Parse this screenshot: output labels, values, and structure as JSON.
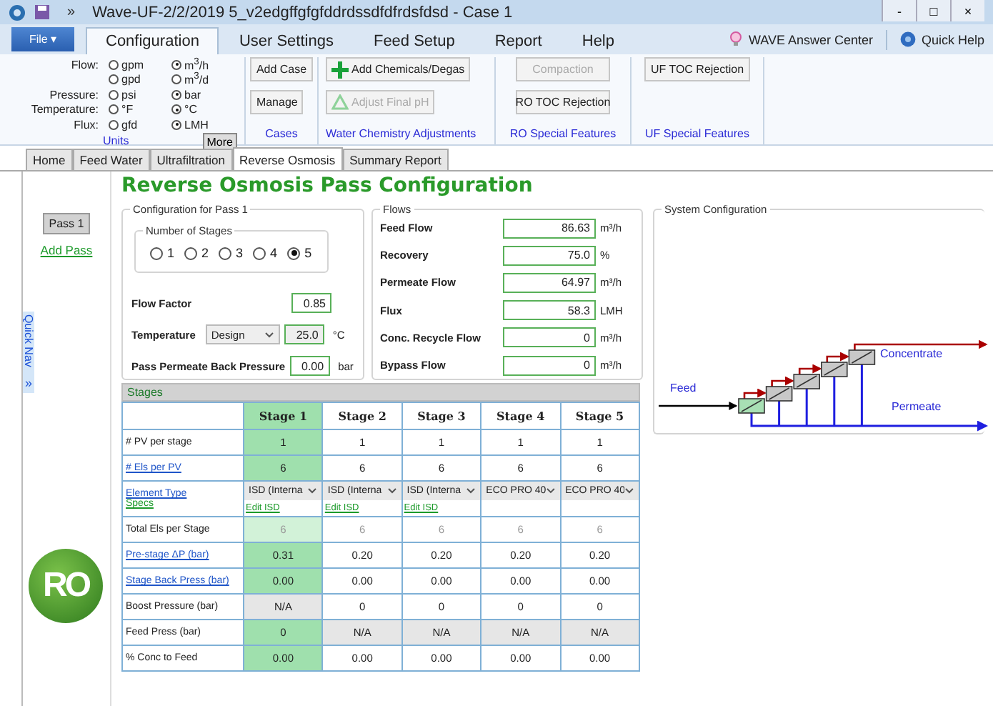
{
  "window": {
    "title": "Wave-UF-2/2/2019 5_v2edgffgfgfddrdssdfdfrdsfdsd - Case 1",
    "overflow": "»",
    "controls": [
      "-",
      "□",
      "×"
    ]
  },
  "ribbon": {
    "file": "File ▾",
    "tabs": [
      {
        "label": "Configuration",
        "selected": true
      },
      {
        "label": "User Settings",
        "selected": false
      },
      {
        "label": "Feed Setup",
        "selected": false
      },
      {
        "label": "Report",
        "selected": false
      },
      {
        "label": "Help",
        "selected": false
      }
    ],
    "links": [
      {
        "label": "WAVE Answer Center"
      },
      {
        "label": "Quick Help"
      }
    ],
    "units": {
      "title": "Units",
      "more": "More",
      "rows": [
        {
          "label": "Flow:",
          "options": [
            {
              "label": "gpm",
              "selected": false
            },
            {
              "label": "m$^{3}$/h",
              "selected": true
            }
          ]
        },
        {
          "options": [
            {
              "label": "gpd",
              "selected": false
            },
            {
              "label": "m$^{3}$/d",
              "selected": false
            }
          ]
        },
        {
          "label": "Pressure:",
          "options": [
            {
              "label": "psi",
              "selected": false
            },
            {
              "label": "bar",
              "selected": true
            }
          ]
        },
        {
          "label": "Temperature:",
          "options": [
            {
              "label": "°F",
              "selected": false
            },
            {
              "label": "°C",
              "selected": true
            }
          ]
        },
        {
          "label": "Flux:",
          "options": [
            {
              "label": "gfd",
              "selected": false
            },
            {
              "label": "LMH",
              "selected": true
            }
          ]
        }
      ]
    },
    "groups": [
      {
        "kind": "cases",
        "title": "Cases",
        "buttons": [
          {
            "label": "Add Case",
            "disabled": false
          },
          {
            "label": "Manage",
            "disabled": false
          }
        ]
      },
      {
        "kind": "chemistry",
        "title": "Water Chemistry Adjustments",
        "buttons": [
          {
            "label": "Add Chemicals/Degas",
            "disabled": false
          },
          {
            "label": "Adjust Final pH",
            "disabled": true
          }
        ]
      },
      {
        "kind": "ro",
        "title": "RO Special Features",
        "buttons": [
          {
            "label": "Compaction",
            "disabled": true
          },
          {
            "label": "RO TOC Rejection",
            "disabled": false
          }
        ]
      },
      {
        "kind": "uf",
        "title": "UF Special Features",
        "buttons": [
          {
            "label": "UF TOC Rejection",
            "disabled": false
          }
        ]
      }
    ]
  },
  "page_tabs": [
    {
      "label": "Home",
      "selected": false
    },
    {
      "label": "Feed Water",
      "selected": false
    },
    {
      "label": "Ultrafiltration",
      "selected": false
    },
    {
      "label": "Reverse Osmosis",
      "selected": true
    },
    {
      "label": "Summary Report",
      "selected": false
    }
  ],
  "sidebar": {
    "passes": [
      {
        "label": "Pass 1",
        "selected": true
      }
    ],
    "add_pass": "Add Pass",
    "quick_nav": "Quick Nav",
    "expand": "»",
    "logo_text": "RO"
  },
  "heading": "Reverse Osmosis Pass Configuration",
  "configuration": {
    "title": "Configuration for Pass 1",
    "stages_title": "Number of Stages",
    "stage_options": [
      {
        "label": "1",
        "selected": false
      },
      {
        "label": "2",
        "selected": false
      },
      {
        "label": "3",
        "selected": false
      },
      {
        "label": "4",
        "selected": false
      },
      {
        "label": "5",
        "selected": true
      }
    ],
    "flow_factor": {
      "label": "Flow Factor",
      "value": "0.85"
    },
    "temperature": {
      "label": "Temperature",
      "mode": "Design",
      "value": "25.0",
      "unit": "°C"
    },
    "back_pressure": {
      "label": "Pass Permeate Back Pressure",
      "value": "0.00",
      "unit": "bar"
    }
  },
  "flows": {
    "title": "Flows",
    "rows": [
      {
        "label": "Feed Flow",
        "value": "86.63",
        "unit": "m³/h"
      },
      {
        "label": "Recovery",
        "value": "75.0",
        "unit": "%"
      },
      {
        "label": "Permeate Flow",
        "value": "64.97",
        "unit": "m³/h"
      },
      {
        "label": "Flux",
        "value": "58.3",
        "unit": "LMH"
      },
      {
        "label": "Conc. Recycle Flow",
        "value": "0",
        "unit": "m³/h"
      },
      {
        "label": "Bypass Flow",
        "value": "0",
        "unit": "m³/h"
      }
    ]
  },
  "system_configuration": {
    "title": "System Configuration",
    "feed": "Feed",
    "concentrate": "Concentrate",
    "permeate": "Permeate"
  },
  "stages": {
    "title": "Stages",
    "columns": [
      {
        "label": "Stage 1",
        "selected": true
      },
      {
        "label": "Stage 2",
        "selected": false
      },
      {
        "label": "Stage 3",
        "selected": false
      },
      {
        "label": "Stage 4",
        "selected": false
      },
      {
        "label": "Stage 5",
        "selected": false
      }
    ],
    "rows": [
      {
        "kind": "value",
        "label": "# PV per stage",
        "link": false,
        "cells": [
          {
            "value": "1",
            "disabled": false,
            "readonly": false
          },
          {
            "value": "1",
            "disabled": false,
            "readonly": false
          },
          {
            "value": "1",
            "disabled": false,
            "readonly": false
          },
          {
            "value": "1",
            "disabled": false,
            "readonly": false
          },
          {
            "value": "1",
            "disabled": false,
            "readonly": false
          }
        ]
      },
      {
        "kind": "value",
        "label": "# Els per PV",
        "link": true,
        "cells": [
          {
            "value": "6",
            "disabled": false,
            "readonly": false
          },
          {
            "value": "6",
            "disabled": false,
            "readonly": false
          },
          {
            "value": "6",
            "disabled": false,
            "readonly": false
          },
          {
            "value": "6",
            "disabled": false,
            "readonly": false
          },
          {
            "value": "6",
            "disabled": false,
            "readonly": false
          }
        ]
      },
      {
        "kind": "element",
        "label": "Element Type",
        "sublabel": "Specs",
        "link": true,
        "cells": [
          {
            "value": "ISD (Interna",
            "edit": "Edit ISD"
          },
          {
            "value": "ISD (Interna",
            "edit": "Edit ISD"
          },
          {
            "value": "ISD (Interna",
            "edit": "Edit ISD"
          },
          {
            "value": "ECO PRO 40"
          },
          {
            "value": "ECO PRO 40"
          }
        ]
      },
      {
        "kind": "value",
        "label": "Total Els per Stage",
        "link": false,
        "cells": [
          {
            "value": "6",
            "disabled": false,
            "readonly": true
          },
          {
            "value": "6",
            "disabled": false,
            "readonly": true
          },
          {
            "value": "6",
            "disabled": false,
            "readonly": true
          },
          {
            "value": "6",
            "disabled": false,
            "readonly": true
          },
          {
            "value": "6",
            "disabled": false,
            "readonly": true
          }
        ]
      },
      {
        "kind": "value",
        "label": "Pre-stage ΔP (bar)",
        "link": true,
        "cells": [
          {
            "value": "0.31",
            "disabled": false,
            "readonly": false
          },
          {
            "value": "0.20",
            "disabled": false,
            "readonly": false
          },
          {
            "value": "0.20",
            "disabled": false,
            "readonly": false
          },
          {
            "value": "0.20",
            "disabled": false,
            "readonly": false
          },
          {
            "value": "0.20",
            "disabled": false,
            "readonly": false
          }
        ]
      },
      {
        "kind": "value",
        "label": "Stage Back Press (bar)",
        "link": true,
        "cells": [
          {
            "value": "0.00",
            "disabled": false,
            "readonly": false
          },
          {
            "value": "0.00",
            "disabled": false,
            "readonly": false
          },
          {
            "value": "0.00",
            "disabled": false,
            "readonly": false
          },
          {
            "value": "0.00",
            "disabled": false,
            "readonly": false
          },
          {
            "value": "0.00",
            "disabled": false,
            "readonly": false
          }
        ]
      },
      {
        "kind": "value",
        "label": "Boost Pressure (bar)",
        "link": false,
        "cells": [
          {
            "value": "N/A",
            "disabled": true,
            "readonly": false
          },
          {
            "value": "0",
            "disabled": false,
            "readonly": false
          },
          {
            "value": "0",
            "disabled": false,
            "readonly": false
          },
          {
            "value": "0",
            "disabled": false,
            "readonly": false
          },
          {
            "value": "0",
            "disabled": false,
            "readonly": false
          }
        ]
      },
      {
        "kind": "value",
        "label": "Feed Press (bar)",
        "link": false,
        "cells": [
          {
            "value": "0",
            "disabled": false,
            "readonly": false
          },
          {
            "value": "N/A",
            "disabled": true,
            "readonly": false
          },
          {
            "value": "N/A",
            "disabled": true,
            "readonly": false
          },
          {
            "value": "N/A",
            "disabled": true,
            "readonly": false
          },
          {
            "value": "N/A",
            "disabled": true,
            "readonly": false
          }
        ]
      },
      {
        "kind": "value",
        "label": "% Conc to Feed",
        "link": false,
        "cells": [
          {
            "value": "0.00",
            "disabled": false,
            "readonly": false
          },
          {
            "value": "0.00",
            "disabled": false,
            "readonly": false
          },
          {
            "value": "0.00",
            "disabled": false,
            "readonly": false
          },
          {
            "value": "0.00",
            "disabled": false,
            "readonly": false
          },
          {
            "value": "0.00",
            "disabled": false,
            "readonly": false
          }
        ]
      }
    ]
  }
}
